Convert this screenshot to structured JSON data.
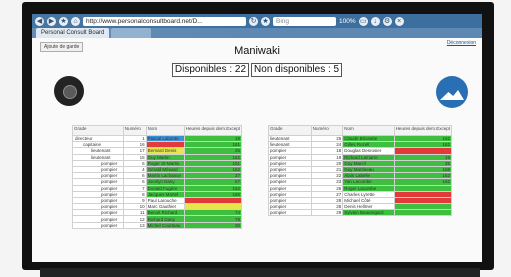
{
  "browser": {
    "url": "http://www.personalconsultboard.net/D...",
    "search_placeholder": "Bing",
    "zoom": "100%",
    "tabs": [
      {
        "label": "Personal Consult Board",
        "active": true
      },
      {
        "label": "",
        "active": false
      }
    ]
  },
  "page": {
    "top_button": "Ajoute de garde",
    "logout": "Déconnexion",
    "title": "Maniwaki",
    "available": "Disponibles : 22",
    "unavailable": "Non disponibles : 5"
  },
  "left_table": {
    "headers": [
      "Grade",
      "Numéro",
      "Nom",
      "Heures depuis dern.Except"
    ],
    "rows": [
      {
        "grade": "directeur",
        "num": "1",
        "nom": "Pascal Labonte",
        "color": "blue",
        "heures": "19",
        "hcolor": "green"
      },
      {
        "grade": "capitaine",
        "num": "16",
        "nom": "",
        "color": "red",
        "heures": "161",
        "hcolor": "green"
      },
      {
        "grade": "lieutenant",
        "num": "17",
        "nom": "Bernard Denis",
        "color": "yellow",
        "heures": "25",
        "hcolor": "green"
      },
      {
        "grade": "lieutenant",
        "num": "15",
        "nom": "Guy Martin",
        "color": "green",
        "heures": "162",
        "hcolor": "green"
      },
      {
        "grade": "pompier",
        "num": "5",
        "nom": "Roger St-Martin",
        "color": "green",
        "heures": "161",
        "hcolor": "green"
      },
      {
        "grade": "pompier",
        "num": "4",
        "nom": "Gerald Ménard",
        "color": "green",
        "heures": "162",
        "hcolor": "green"
      },
      {
        "grade": "pompier",
        "num": "6",
        "nom": "Martin Lachance",
        "color": "green",
        "heures": "27",
        "hcolor": "green"
      },
      {
        "grade": "pompier",
        "num": "6",
        "nom": "Jocelyn Dany",
        "color": "green",
        "heures": "57",
        "hcolor": "green"
      },
      {
        "grade": "pompier",
        "num": "7",
        "nom": "Donald Fugère",
        "color": "green",
        "heures": "162",
        "hcolor": "green"
      },
      {
        "grade": "pompier",
        "num": "8",
        "nom": "Jacques Martel",
        "color": "green",
        "heures": "166",
        "hcolor": "green"
      },
      {
        "grade": "pompier",
        "num": "9",
        "nom": "Paul Larouche",
        "color": "white",
        "heures": "",
        "hcolor": "red"
      },
      {
        "grade": "pompier",
        "num": "10",
        "nom": "Marc Gauthier",
        "color": "white",
        "heures": "",
        "hcolor": "yellow"
      },
      {
        "grade": "pompier",
        "num": "11",
        "nom": "Benoit Richard",
        "color": "green",
        "heures": "74",
        "hcolor": "green"
      },
      {
        "grade": "pompier",
        "num": "12",
        "nom": "Richard Dany",
        "color": "green",
        "heures": "78",
        "hcolor": "green"
      },
      {
        "grade": "pompier",
        "num": "13",
        "nom": "Michel Courteau",
        "color": "green",
        "heures": "30",
        "hcolor": "green"
      }
    ]
  },
  "right_table": {
    "headers": [
      "Grade",
      "Numéro",
      "Nom",
      "Heures depuis dern.Except"
    ],
    "rows": [
      {
        "grade": "lieutenant",
        "num": "25",
        "nom": "Claude Brissette",
        "color": "green",
        "heures": "162",
        "hcolor": "green"
      },
      {
        "grade": "lieutenant",
        "num": "24",
        "nom": "Gilles Rozell",
        "color": "green",
        "heures": "162",
        "hcolor": "green"
      },
      {
        "grade": "pompier",
        "num": "18",
        "nom": "Douglas Desrosier",
        "color": "white",
        "heures": "",
        "hcolor": "red"
      },
      {
        "grade": "pompier",
        "num": "19",
        "nom": "Richard Lamarre",
        "color": "green",
        "heures": "19",
        "hcolor": "green"
      },
      {
        "grade": "pompier",
        "num": "20",
        "nom": "Guy Marcil",
        "color": "green",
        "heures": "25",
        "hcolor": "green"
      },
      {
        "grade": "pompier",
        "num": "21",
        "nom": "Guy Martineau",
        "color": "green",
        "heures": "168",
        "hcolor": "green"
      },
      {
        "grade": "pompier",
        "num": "22",
        "nom": "Alain Labelle",
        "color": "green",
        "heures": "162",
        "hcolor": "green"
      },
      {
        "grade": "pompier",
        "num": "23",
        "nom": "Yan Lacombe",
        "color": "green",
        "heures": "162",
        "hcolor": "green"
      },
      {
        "grade": "pompier",
        "num": "26",
        "nom": "Roger Lacombe",
        "color": "green",
        "heures": "",
        "hcolor": "green"
      },
      {
        "grade": "pompier",
        "num": "27",
        "nom": "Charles Lyrette",
        "color": "white",
        "heures": "",
        "hcolor": "red"
      },
      {
        "grade": "pompier",
        "num": "28",
        "nom": "Michael Côté",
        "color": "white",
        "heures": "",
        "hcolor": "red"
      },
      {
        "grade": "pompier",
        "num": "28",
        "nom": "Denis Hellmer",
        "color": "white",
        "heures": "",
        "hcolor": "green"
      },
      {
        "grade": "pompier",
        "num": "29",
        "nom": "Sylvain Beauregard",
        "color": "green",
        "heures": "",
        "hcolor": "green"
      }
    ]
  }
}
